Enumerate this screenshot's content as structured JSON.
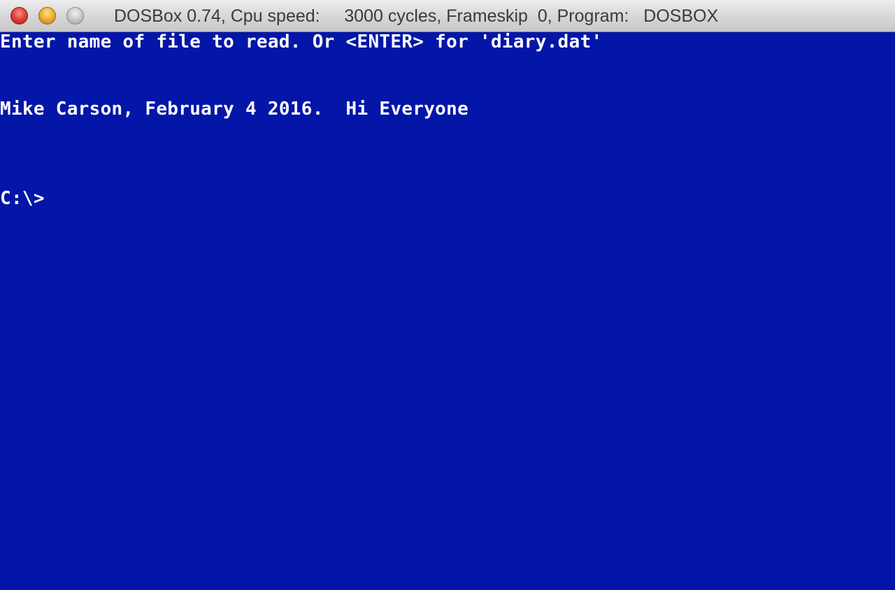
{
  "window": {
    "title": "DOSBox 0.74, Cpu speed:     3000 cycles, Frameskip  0, Program:   DOSBOX"
  },
  "colors": {
    "screen_background": "#0416a8",
    "screen_text": "#ffffff"
  },
  "terminal": {
    "lines": [
      "Enter name of file to read. Or <ENTER> for 'diary.dat'",
      "Mike Carson, February 4 2016.  Hi Everyone",
      "C:\\>"
    ]
  }
}
